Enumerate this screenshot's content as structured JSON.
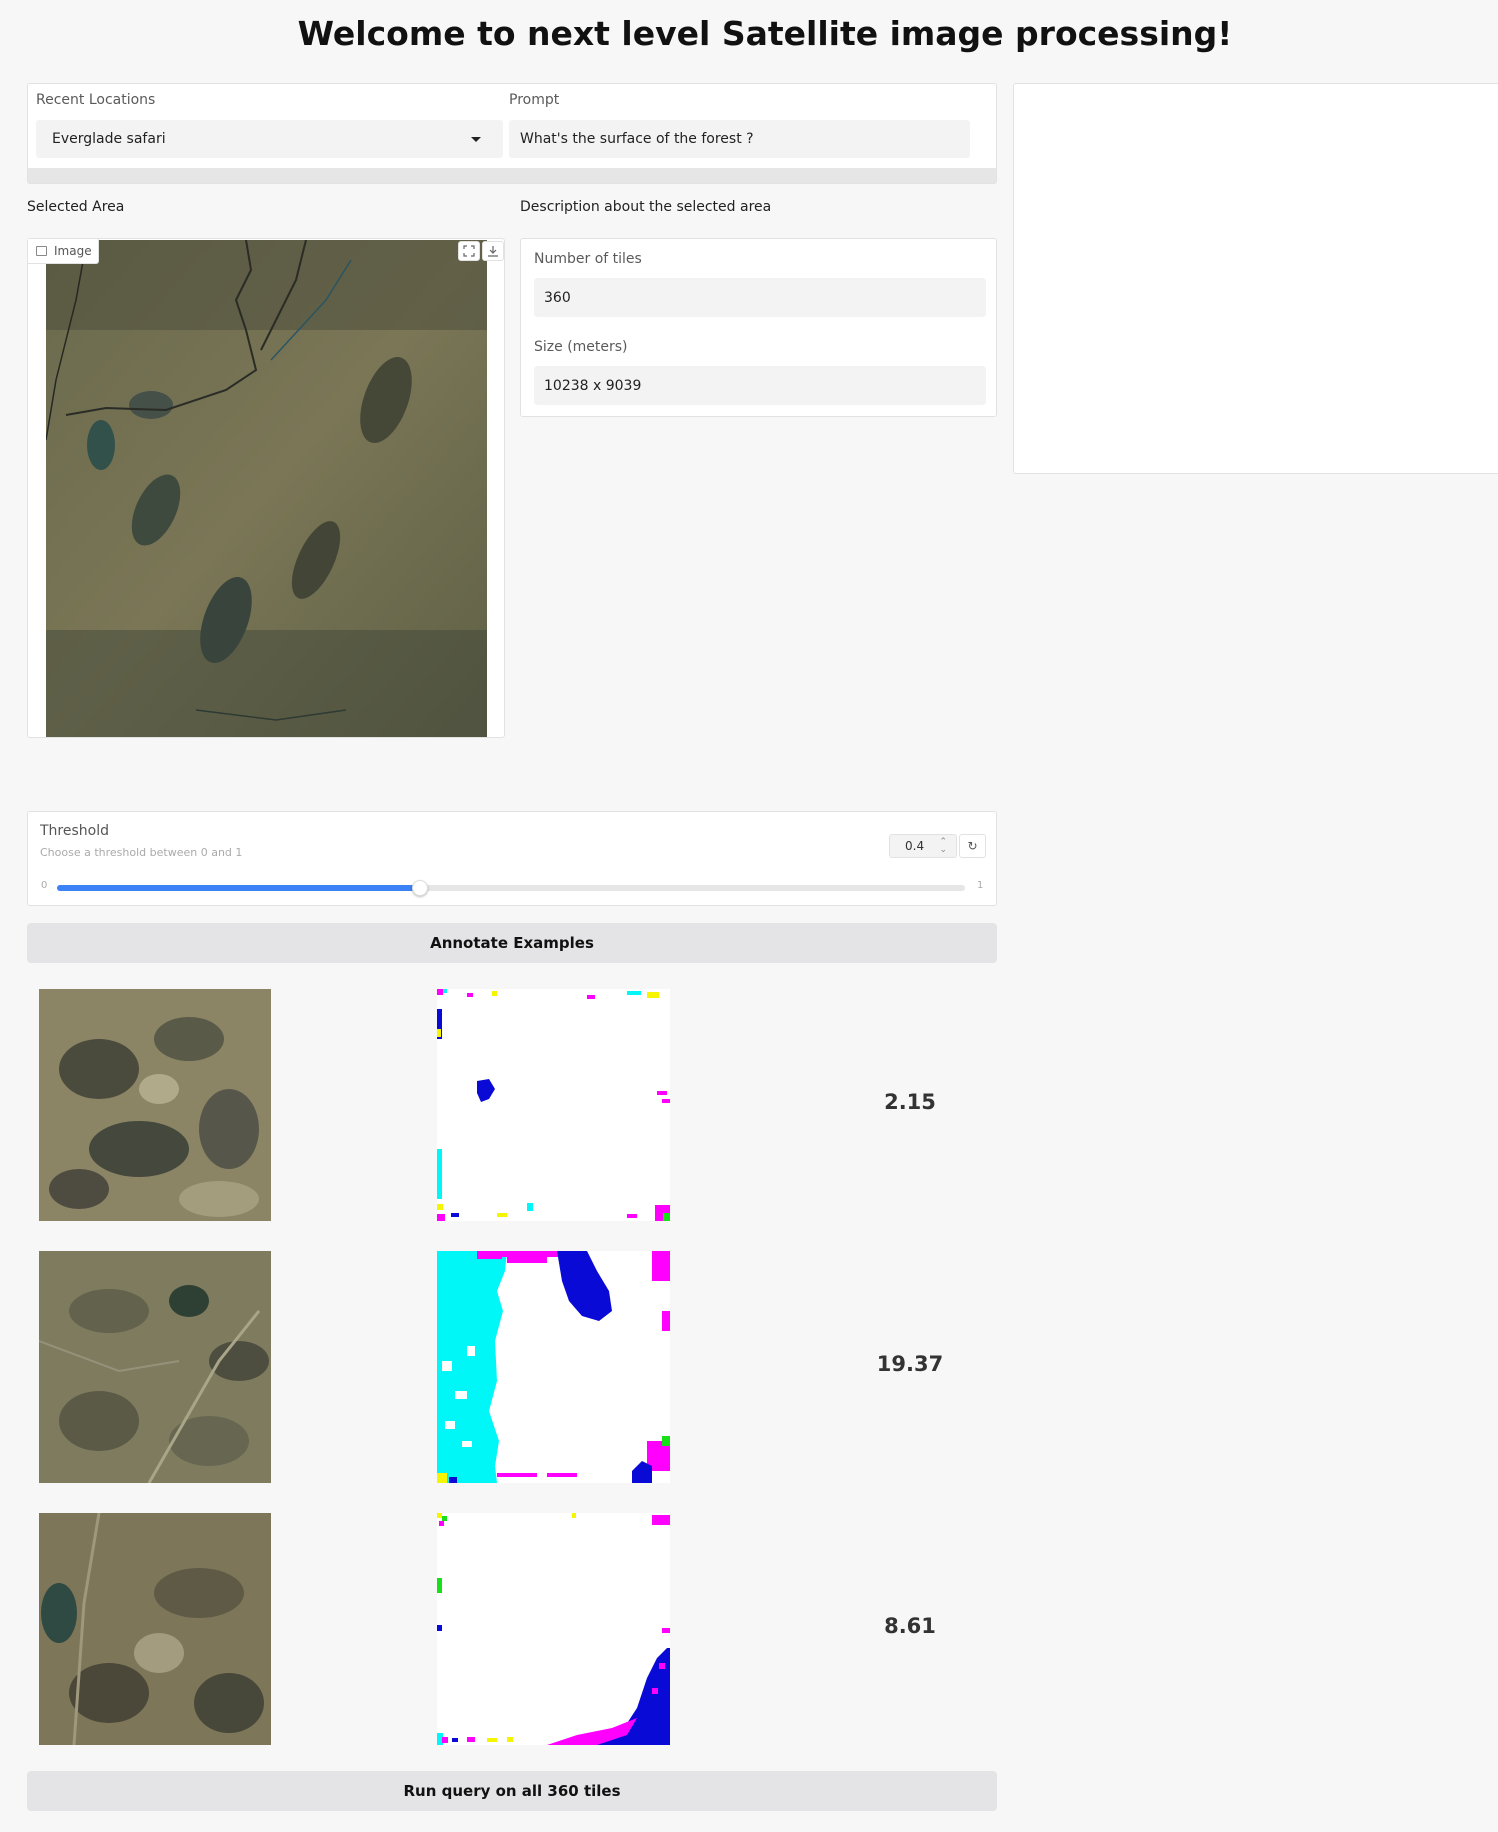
{
  "header": {
    "title": "Welcome to next level Satellite image processing!"
  },
  "inputs": {
    "recent_locations_label": "Recent Locations",
    "recent_locations_value": "Everglade safari",
    "prompt_label": "Prompt",
    "prompt_value": "What's the surface of the forest ?"
  },
  "selected_area": {
    "label": "Selected Area",
    "image_tag": "Image",
    "icons": [
      "image-icon",
      "fullscreen-icon",
      "download-icon"
    ]
  },
  "description": {
    "label": "Description about the selected area",
    "tiles_label": "Number of tiles",
    "tiles_value": "360",
    "size_label": "Size (meters)",
    "size_value": "10238 x 9039"
  },
  "threshold": {
    "label": "Threshold",
    "info": "Choose a threshold between 0 and 1",
    "value": "0.4",
    "min_label": "0",
    "max_label": "1",
    "fraction": 0.4,
    "icons": [
      "spin-arrows-icon",
      "reset-icon"
    ]
  },
  "annotate_button": "Annotate Examples",
  "examples": [
    {
      "value": "2.15"
    },
    {
      "value": "19.37"
    },
    {
      "value": "8.61"
    }
  ],
  "run_button": "Run query on all 360 tiles",
  "colors": {
    "accent": "#3b82f6",
    "mask_blue": "#0a0ad6",
    "mask_cyan": "#00f7f7",
    "mask_magenta": "#ff00ff",
    "mask_yellow": "#f5f500",
    "mask_green": "#18e018"
  }
}
